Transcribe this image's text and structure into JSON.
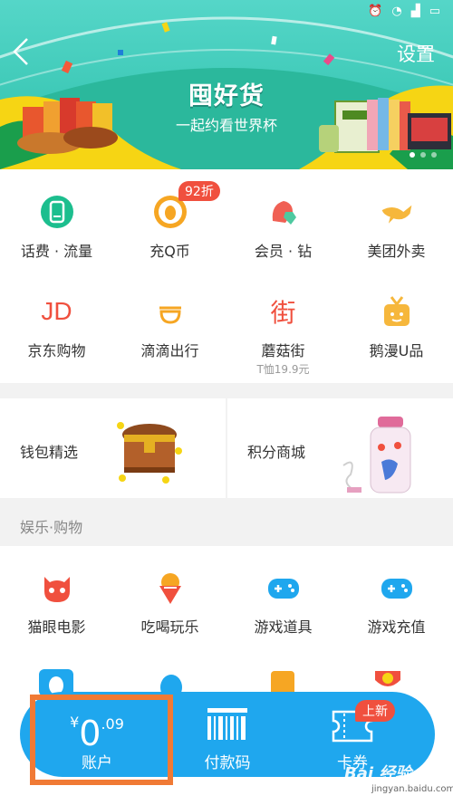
{
  "header": {
    "settings_label": "设置",
    "banner_title": "囤好货",
    "banner_subtitle": "一起约看世界杯"
  },
  "services": [
    {
      "label": "话费 · 流量",
      "icon": "phone-icon"
    },
    {
      "label": "充Q币",
      "icon": "qq-coin-icon",
      "badge": "92折"
    },
    {
      "label": "会员 · 钻",
      "icon": "vip-diamond-icon"
    },
    {
      "label": "美团外卖",
      "icon": "kangaroo-icon"
    },
    {
      "label": "京东购物",
      "icon": "jd-icon",
      "icon_text": "JD"
    },
    {
      "label": "滴滴出行",
      "icon": "didi-icon"
    },
    {
      "label": "蘑菇街",
      "icon": "mogujie-icon",
      "icon_text": "街",
      "sub": "T恤19.9元"
    },
    {
      "label": "鹅漫U品",
      "icon": "gift-tv-icon"
    }
  ],
  "promos": [
    {
      "label": "钱包精选",
      "icon": "treasure-chest-icon"
    },
    {
      "label": "积分商城",
      "icon": "bottle-icon"
    }
  ],
  "section": {
    "title": "娱乐·购物"
  },
  "entertainment": [
    {
      "label": "猫眼电影",
      "icon": "cat-eye-icon"
    },
    {
      "label": "吃喝玩乐",
      "icon": "ice-cream-icon"
    },
    {
      "label": "游戏道具",
      "icon": "gamepad-icon"
    },
    {
      "label": "游戏充值",
      "icon": "gamepad-plus-icon"
    }
  ],
  "bottom_bar": {
    "account": {
      "currency": "¥",
      "amount": "0",
      "cents": ".09",
      "label": "账户"
    },
    "pay_code": {
      "label": "付款码"
    },
    "card": {
      "label": "卡券",
      "badge": "上新"
    }
  },
  "watermark": {
    "text": "Bai 经验",
    "sub": "jingyan.baidu.com"
  },
  "colors": {
    "accent": "#1fa7ee",
    "highlight": "#f07a35",
    "badge": "#f0503e"
  }
}
